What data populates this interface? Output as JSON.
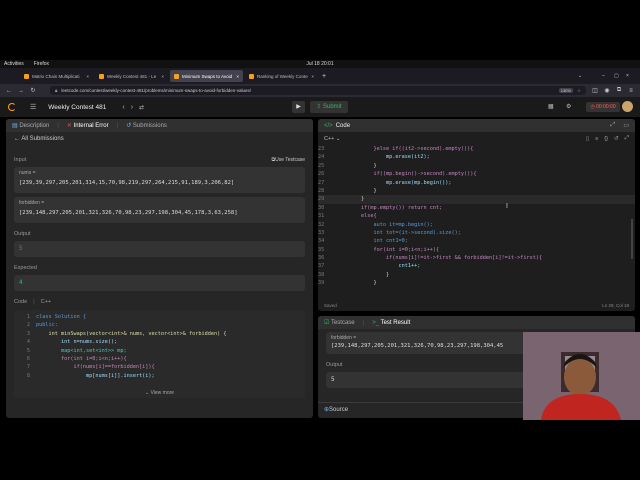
{
  "system": {
    "activities": "Activities",
    "browser_name": "Firefox",
    "clock": "Jul 18 20:01"
  },
  "tabs": [
    {
      "label": "Matrix Chain Multiplicati",
      "active": false
    },
    {
      "label": "Weekly Contest 481 - Le",
      "active": false
    },
    {
      "label": "Minimum Swaps to Avoid",
      "active": true
    },
    {
      "label": "Ranking of Weekly Conte",
      "active": false
    }
  ],
  "url": {
    "value": "leetcode.com/contest/weekly-contest-481/problems/minimum-swaps-to-avoid-forbidden-values/",
    "zoom": "130%"
  },
  "header": {
    "contest_name": "Weekly Contest 481",
    "submit_label": "Submit",
    "timer": "00:00:00"
  },
  "left": {
    "tabs": [
      "Description",
      "Internal Error",
      "Submissions"
    ],
    "all_submissions": "All Submissions",
    "input_label": "Input",
    "use_testcase": "Use Testcase",
    "nums_name": "nums =",
    "nums_value": "[239,39,297,205,201,314,15,70,98,219,297,264,215,91,189,3,206,82]",
    "forbidden_name": "forbidden =",
    "forbidden_value": "[239,148,297,205,201,321,326,70,98,23,297,198,304,45,178,3,63,258]",
    "output_label": "Output",
    "output_value": "5",
    "expected_label": "Expected",
    "expected_value": "4",
    "code_label": "Code",
    "code_lang": "C++",
    "view_more": "View more",
    "code_lines": [
      {
        "n": "1",
        "t": "class Solution {"
      },
      {
        "n": "2",
        "t": "public:"
      },
      {
        "n": "3",
        "t": "    int minSwaps(vector<int>& nums, vector<int>& forbidden) {"
      },
      {
        "n": "4",
        "t": "        int n=nums.size();"
      },
      {
        "n": "5",
        "t": "        map<int,set<int>> mp;"
      },
      {
        "n": "6",
        "t": "        for(int i=0;i<n;i++){"
      },
      {
        "n": "7",
        "t": "            if(nums[i]==forbidden[i]){"
      },
      {
        "n": "8",
        "t": "                mp[nums[i]].insert(i);"
      }
    ]
  },
  "code_panel": {
    "title": "Code",
    "lang": "C++",
    "saved": "Saved",
    "cursor": "Ln 29, Col 18",
    "lines": [
      {
        "n": "23",
        "t": "            }else if((it2->second).empty()){"
      },
      {
        "n": "24",
        "t": "                mp.erase(it2);"
      },
      {
        "n": "25",
        "t": "            }"
      },
      {
        "n": "26",
        "t": "            if((mp.begin()->second).empty()){"
      },
      {
        "n": "27",
        "t": "                mp.erase(mp.begin());"
      },
      {
        "n": "28",
        "t": "            }"
      },
      {
        "n": "29",
        "t": "        }"
      },
      {
        "n": "30",
        "t": "        if(mp.empty()) return cnt;"
      },
      {
        "n": "31",
        "t": "        else{"
      },
      {
        "n": "32",
        "t": "            auto it=mp.begin();"
      },
      {
        "n": "33",
        "t": "            int tot=(it->second).size();"
      },
      {
        "n": "34",
        "t": "            int cnt1=0;"
      },
      {
        "n": "35",
        "t": "            for(int i=0;i<n;i++){"
      },
      {
        "n": "36",
        "t": "                if(nums[i]!=it->first && forbidden[i]!=it->first){"
      },
      {
        "n": "37",
        "t": "                    cnt1++;"
      },
      {
        "n": "38",
        "t": "                }"
      },
      {
        "n": "39",
        "t": "            }"
      }
    ]
  },
  "result_panel": {
    "tabs": [
      "Testcase",
      "Test Result"
    ],
    "forbidden_name": "forbidden =",
    "forbidden_value": "[239,148,297,205,201,321,326,70,98,23,297,198,304,45",
    "output_label": "Output",
    "output_value": "5",
    "source_label": "Source"
  },
  "colors": {
    "accent_orange": "#ffa116",
    "submit_green": "#2cbb5d",
    "error_red": "#ef4743",
    "success_green": "#2cbb5d"
  }
}
